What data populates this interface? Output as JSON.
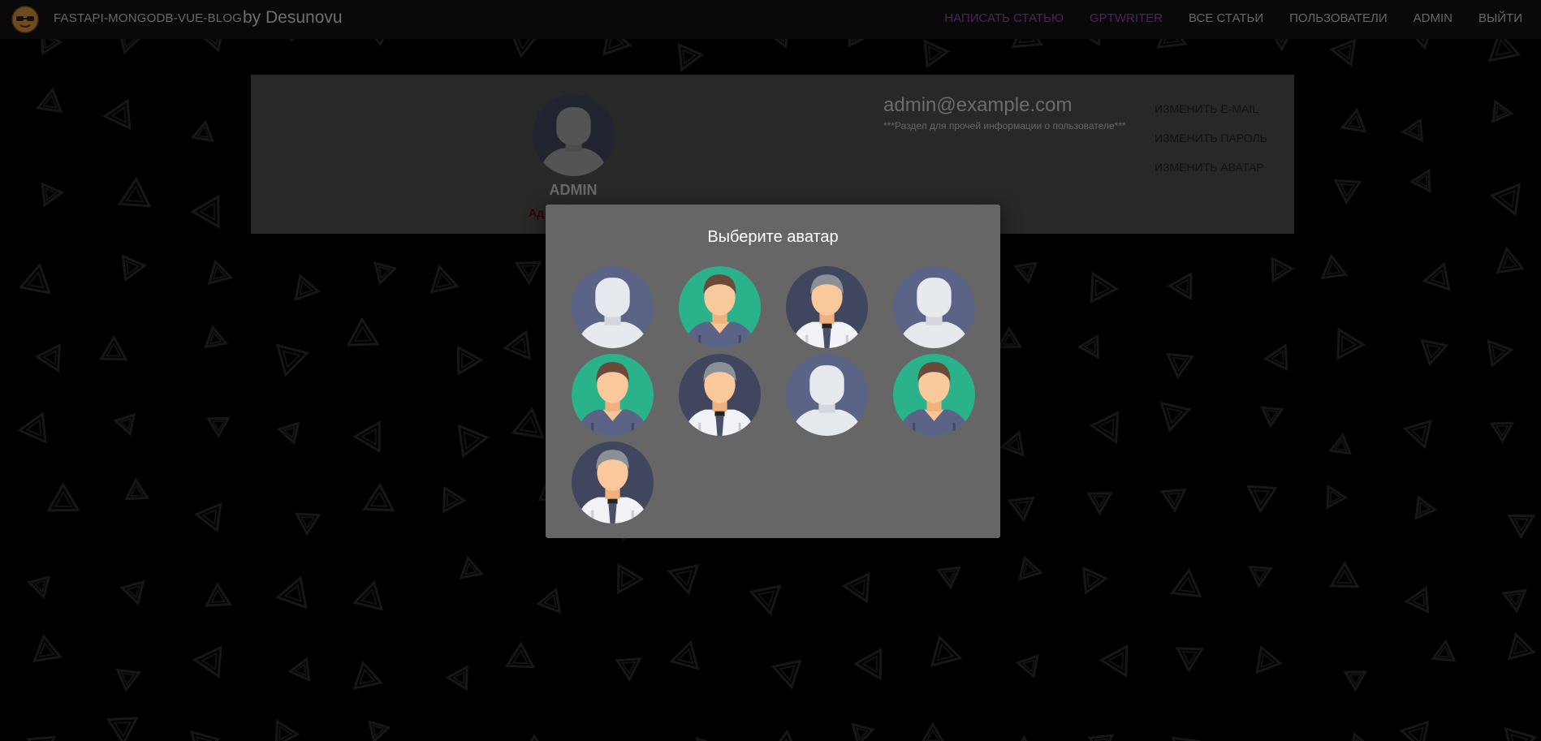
{
  "navbar": {
    "brand": "FASTAPI-MONGODB-VUE-BLOG",
    "by": "by Desunovu",
    "items": [
      {
        "label": "НАПИСАТЬ СТАТЬЮ",
        "accent": true,
        "name": "nav-write-article"
      },
      {
        "label": "GPTWRITER",
        "accent": true,
        "name": "nav-gptwriter"
      },
      {
        "label": "ВСЕ СТАТЬИ",
        "accent": false,
        "name": "nav-all-articles"
      },
      {
        "label": "ПОЛЬЗОВАТЕЛИ",
        "accent": false,
        "name": "nav-users"
      },
      {
        "label": "ADMIN",
        "accent": false,
        "name": "nav-admin"
      },
      {
        "label": "ВЫЙТИ",
        "accent": false,
        "name": "nav-logout"
      }
    ]
  },
  "profile": {
    "name": "ADMIN",
    "partial_label": "Ад",
    "email": "admin@example.com",
    "info": "***Раздел для прочей информации о пользователе***",
    "actions": {
      "change_email": "ИЗМЕНИТЬ E-MAIL",
      "change_password": "ИЗМЕНИТЬ ПАРОЛЬ",
      "change_avatar": "ИЗМЕНИТЬ АВАТАР"
    }
  },
  "modal": {
    "title": "Выберите аватар",
    "avatars": [
      {
        "style": "silhouette"
      },
      {
        "style": "man-green"
      },
      {
        "style": "man-tie"
      },
      {
        "style": "silhouette"
      },
      {
        "style": "man-green"
      },
      {
        "style": "man-tie"
      },
      {
        "style": "silhouette"
      },
      {
        "style": "man-green"
      },
      {
        "style": "man-tie"
      }
    ]
  },
  "colors": {
    "accent": "#8e3ea8",
    "navbar": "#111111",
    "card": "#4a4a4a",
    "modal": "#666666"
  }
}
